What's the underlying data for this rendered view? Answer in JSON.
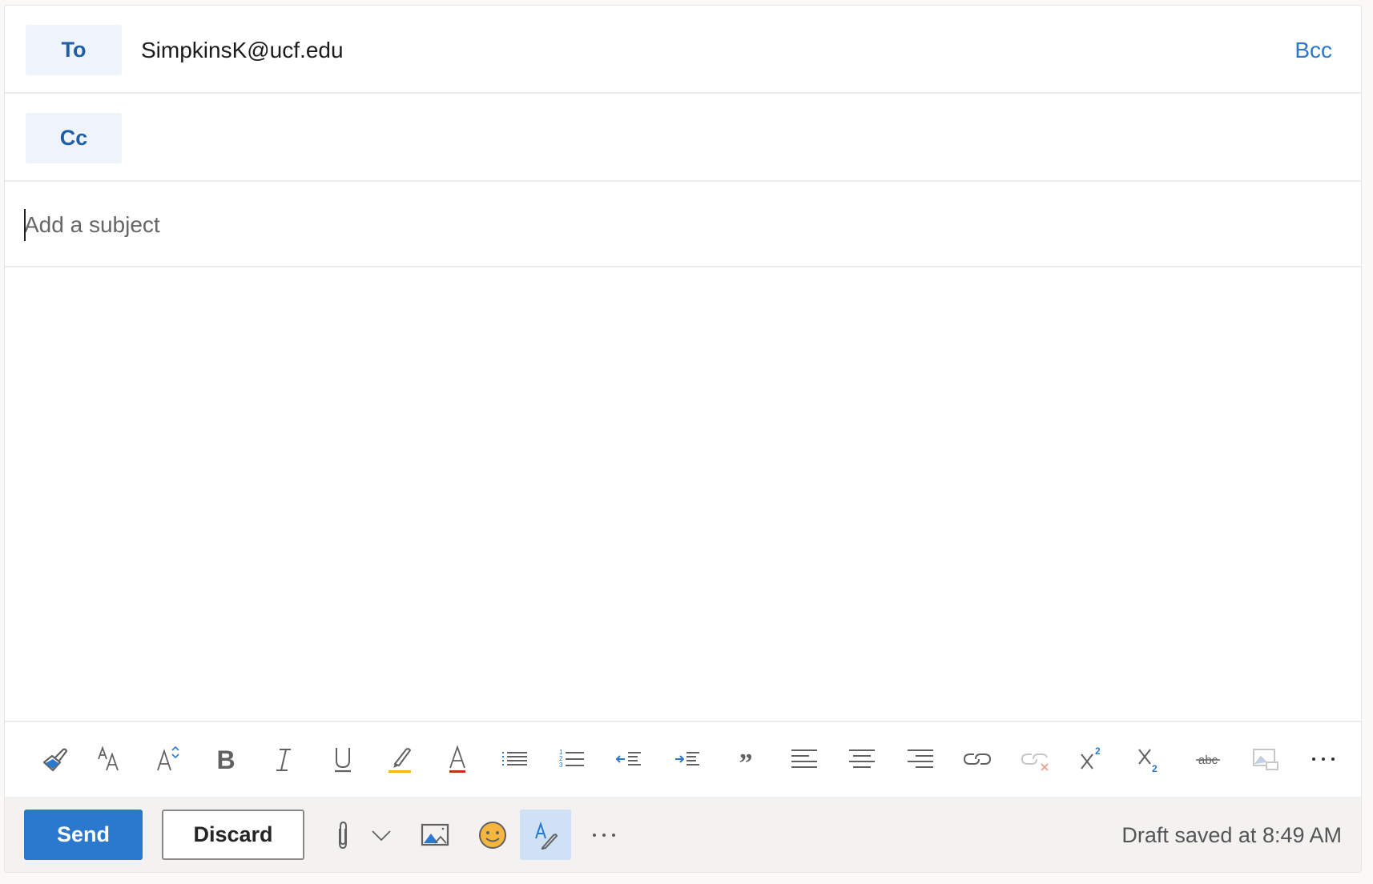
{
  "compose": {
    "to": {
      "label": "To",
      "recipients": [
        "SimpkinsK@ucf.edu"
      ]
    },
    "cc": {
      "label": "Cc"
    },
    "bcc_label": "Bcc",
    "subject": {
      "value": "",
      "placeholder": "Add a subject"
    },
    "body": ""
  },
  "format_toolbar": [
    {
      "name": "format-painter",
      "icon": "paintbrush-icon",
      "title": "Format painter"
    },
    {
      "name": "font-size",
      "icon": "font-size-icon",
      "title": "Font size"
    },
    {
      "name": "grow-shrink-font",
      "icon": "grow-font-icon",
      "title": "Increase/decrease font"
    },
    {
      "name": "bold",
      "icon": "bold-icon",
      "title": "Bold"
    },
    {
      "name": "italic",
      "icon": "italic-icon",
      "title": "Italic"
    },
    {
      "name": "underline",
      "icon": "underline-icon",
      "title": "Underline"
    },
    {
      "name": "highlight",
      "icon": "highlighter-icon",
      "title": "Highlight"
    },
    {
      "name": "font-color",
      "icon": "font-color-icon",
      "title": "Font color"
    },
    {
      "name": "bullets",
      "icon": "bullet-list-icon",
      "title": "Bullets"
    },
    {
      "name": "numbering",
      "icon": "numbered-list-icon",
      "title": "Numbering"
    },
    {
      "name": "decrease-indent",
      "icon": "outdent-icon",
      "title": "Decrease indent"
    },
    {
      "name": "increase-indent",
      "icon": "indent-icon",
      "title": "Increase indent"
    },
    {
      "name": "quote",
      "icon": "quote-icon",
      "title": "Quote"
    },
    {
      "name": "align-left",
      "icon": "align-left-icon",
      "title": "Align left"
    },
    {
      "name": "align-center",
      "icon": "align-center-icon",
      "title": "Align center"
    },
    {
      "name": "align-right",
      "icon": "align-right-icon",
      "title": "Align right"
    },
    {
      "name": "insert-link",
      "icon": "link-icon",
      "title": "Insert link"
    },
    {
      "name": "remove-link",
      "icon": "unlink-icon",
      "title": "Remove link"
    },
    {
      "name": "superscript",
      "icon": "superscript-icon",
      "title": "Superscript"
    },
    {
      "name": "subscript",
      "icon": "subscript-icon",
      "title": "Subscript"
    },
    {
      "name": "strikethrough",
      "icon": "strikethrough-icon",
      "title": "Strikethrough"
    },
    {
      "name": "alt-text",
      "icon": "image-alt-icon",
      "title": "Picture alt text"
    },
    {
      "name": "more-formatting",
      "icon": "more-icon",
      "title": "More options"
    }
  ],
  "bottom_bar": {
    "send_label": "Send",
    "discard_label": "Discard",
    "draft_status": "Draft saved at 8:49 AM"
  },
  "colors": {
    "accent": "#2b78cf",
    "recipient_button_bg": "#eff4fb",
    "recipient_button_text": "#1f5fa6",
    "highlight_yellow": "#f2b51a",
    "font_color_red": "#c4301f",
    "editor_active_bg": "#cfe1f5"
  }
}
